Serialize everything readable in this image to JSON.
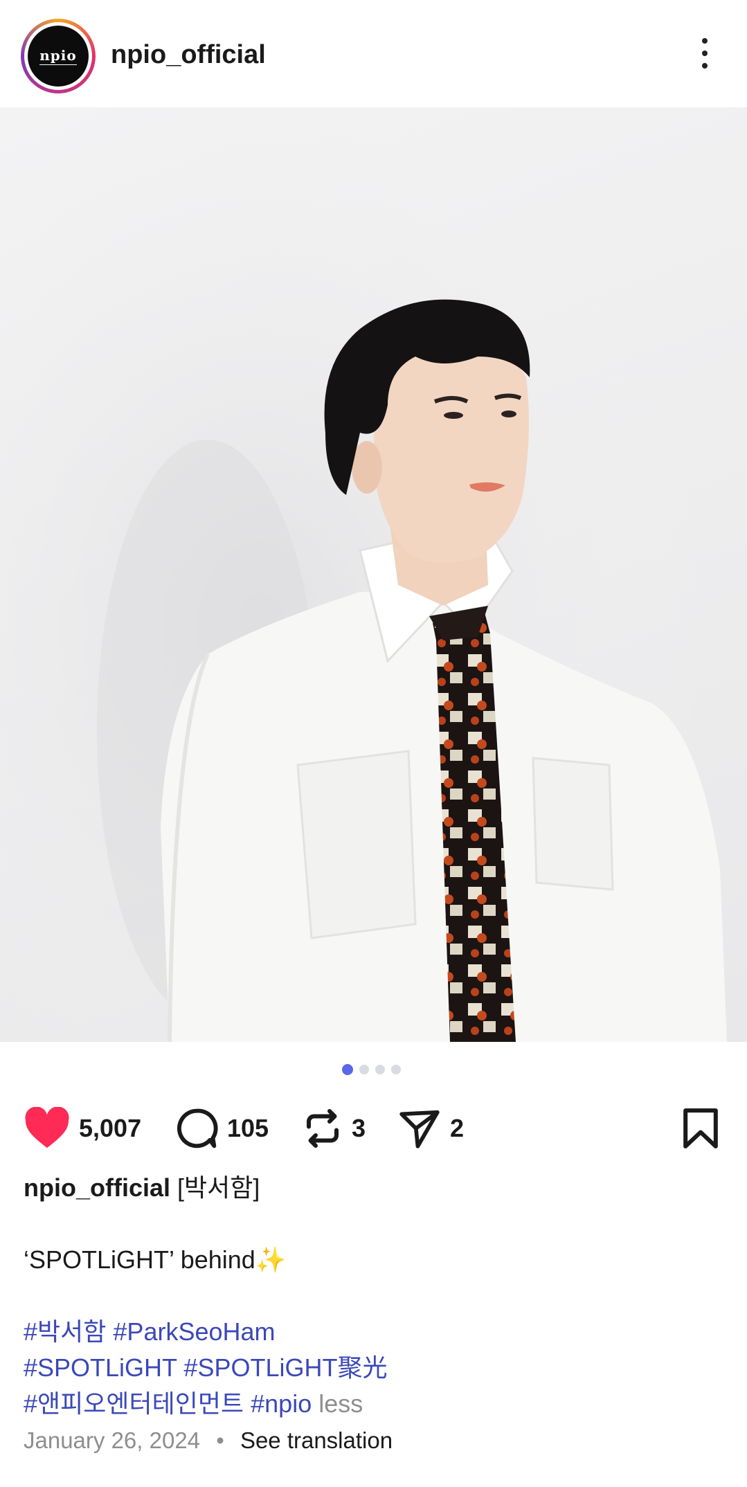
{
  "header": {
    "avatar_text": "npio",
    "username": "npio_official"
  },
  "carousel": {
    "total": 4,
    "current": 1
  },
  "actions": {
    "likes": "5,007",
    "comments": "105",
    "reposts": "3",
    "shares": "2"
  },
  "caption": {
    "username": "npio_official",
    "name_tag": "[박서함]",
    "text": "‘SPOTLiGHT’ behind✨",
    "hashtags_line1": [
      "#박서함",
      "#ParkSeoHam"
    ],
    "hashtags_line2": [
      "#SPOTLiGHT",
      "#SPOTLiGHT聚光"
    ],
    "hashtags_line3": [
      "#앤피오엔터테인먼트",
      "#npio"
    ],
    "less_label": "less"
  },
  "meta": {
    "date": "January 26, 2024",
    "separator": "•",
    "translation_label": "See translation"
  },
  "colors": {
    "like": "#ff2a55",
    "hashtag": "#3b48b8",
    "carousel_active": "#5a67e8"
  }
}
